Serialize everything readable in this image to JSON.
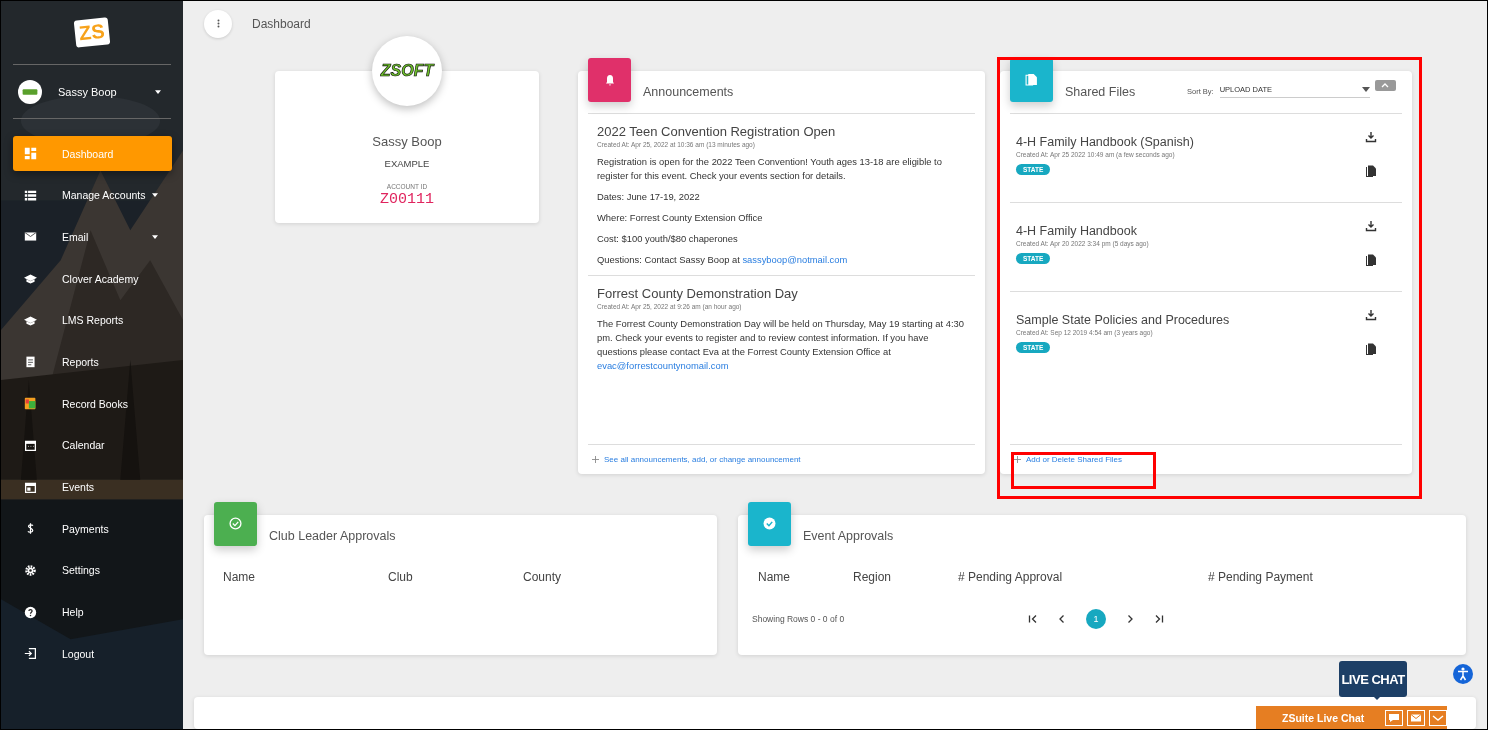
{
  "app_logo": "ZS",
  "user": {
    "name": "Sassy Boop"
  },
  "sidebar": {
    "items": [
      {
        "label": "Dashboard",
        "selected": true,
        "has_menu": false
      },
      {
        "label": "Manage Accounts",
        "selected": false,
        "has_menu": true
      },
      {
        "label": "Email",
        "selected": false,
        "has_menu": true
      },
      {
        "label": "Clover Academy",
        "selected": false,
        "has_menu": false
      },
      {
        "label": "LMS Reports",
        "selected": false,
        "has_menu": false
      },
      {
        "label": "Reports",
        "selected": false,
        "has_menu": false
      },
      {
        "label": "Record Books",
        "selected": false,
        "has_menu": false
      },
      {
        "label": "Calendar",
        "selected": false,
        "has_menu": false
      },
      {
        "label": "Events",
        "selected": false,
        "has_menu": false
      },
      {
        "label": "Payments",
        "selected": false,
        "has_menu": false
      },
      {
        "label": "Settings",
        "selected": false,
        "has_menu": false
      },
      {
        "label": "Help",
        "selected": false,
        "has_menu": false
      },
      {
        "label": "Logout",
        "selected": false,
        "has_menu": false
      }
    ]
  },
  "breadcrumb": "Dashboard",
  "profile": {
    "logo_text": "ZSOFT",
    "name": "Sassy Boop",
    "role": "EXAMPLE",
    "account_id_label": "ACCOUNT ID",
    "account_id": "Z00111"
  },
  "announcements": {
    "title": "Announcements",
    "items": [
      {
        "title": "2022 Teen Convention Registration Open",
        "created": "Created At: Apr 25, 2022 at 10:36 am (13 minutes ago)",
        "paragraphs": [
          {
            "text": "Registration is open for the 2022 Teen Convention! Youth ages 13-18 are eligible to register for this event. Check your events section for details."
          },
          {
            "text": "Dates: June 17-19, 2022"
          },
          {
            "text": "Where: Forrest County Extension Office"
          },
          {
            "text": "Cost: $100 youth/$80 chaperones"
          },
          {
            "text": "Questions: Contact Sassy Boop at",
            "link": "sassyboop@notmail.com"
          }
        ]
      },
      {
        "title": "Forrest County Demonstration Day",
        "created": "Created At: Apr 25, 2022 at 9:26 am (an hour ago)",
        "paragraphs": [
          {
            "text": "The Forrest County Demonstration Day will be held on Thursday, May 19 starting at 4:30 pm. Check your events to register and to review contest information. If you have questions please contact Eva at the Forrest County Extension Office at",
            "link": "evac@forrestcountynomail.com"
          }
        ]
      }
    ],
    "footer_link": "See all announcements, add, or change announcement"
  },
  "shared_files": {
    "title": "Shared Files",
    "sort_label": "Sort By:",
    "sort_value": "UPLOAD DATE",
    "files": [
      {
        "name": "4-H Family Handbook (Spanish)",
        "created": "Created At: Apr 25 2022 10:49 am (a few seconds ago)",
        "tag": "STATE"
      },
      {
        "name": "4-H Family Handbook",
        "created": "Created At: Apr 20 2022 3:34 pm (5 days ago)",
        "tag": "STATE"
      },
      {
        "name": "Sample State Policies and Procedures",
        "created": "Created At: Sep 12 2019 4:54 am (3 years ago)",
        "tag": "STATE"
      }
    ],
    "footer_link": "Add or Delete Shared Files"
  },
  "club_leader_approvals": {
    "title": "Club Leader Approvals",
    "columns": [
      "Name",
      "Club",
      "County"
    ]
  },
  "event_approvals": {
    "title": "Event Approvals",
    "columns": [
      "Name",
      "Region",
      "# Pending Approval",
      "# Pending Payment"
    ],
    "showing": "Showing Rows 0 - 0 of 0",
    "pages": [
      {
        "label": "1",
        "selected": true
      }
    ]
  },
  "live_chat": {
    "bubble": "LIVE CHAT",
    "label": "ZSuite Live Chat"
  }
}
